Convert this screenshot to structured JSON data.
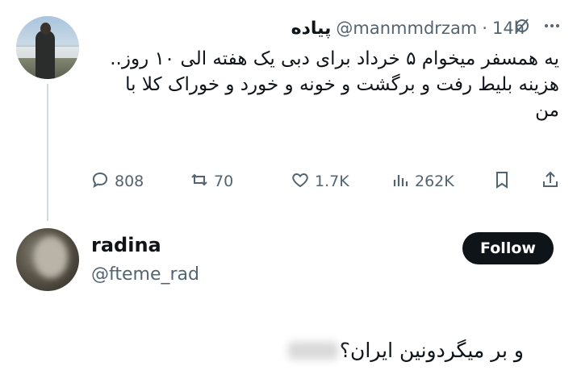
{
  "tweet": {
    "display_name": "پیاده",
    "handle": "@manmmdrzam",
    "separator": "·",
    "time": "14h",
    "lines": [
      "یه همسفر میخوام ۵ خرداد برای دبی یک هفته الی ۱۰ روز..",
      "هزینه بلیط رفت و برگشت و خونه و خورد و خوراک کلا با من"
    ],
    "icons": {
      "grok": "grok-slash-icon",
      "more": "more-dots-icon"
    },
    "actions": {
      "replies": "808",
      "reposts": "70",
      "likes": "1.7K",
      "views": "262K"
    }
  },
  "reply_account": {
    "display_name": "radina",
    "handle": "@fteme_rad",
    "follow_label": "Follow",
    "text": "و بر میگردونین ایران؟"
  },
  "colors": {
    "text": "#0f1419",
    "muted": "#536471",
    "follow_bg": "#0f1419"
  }
}
